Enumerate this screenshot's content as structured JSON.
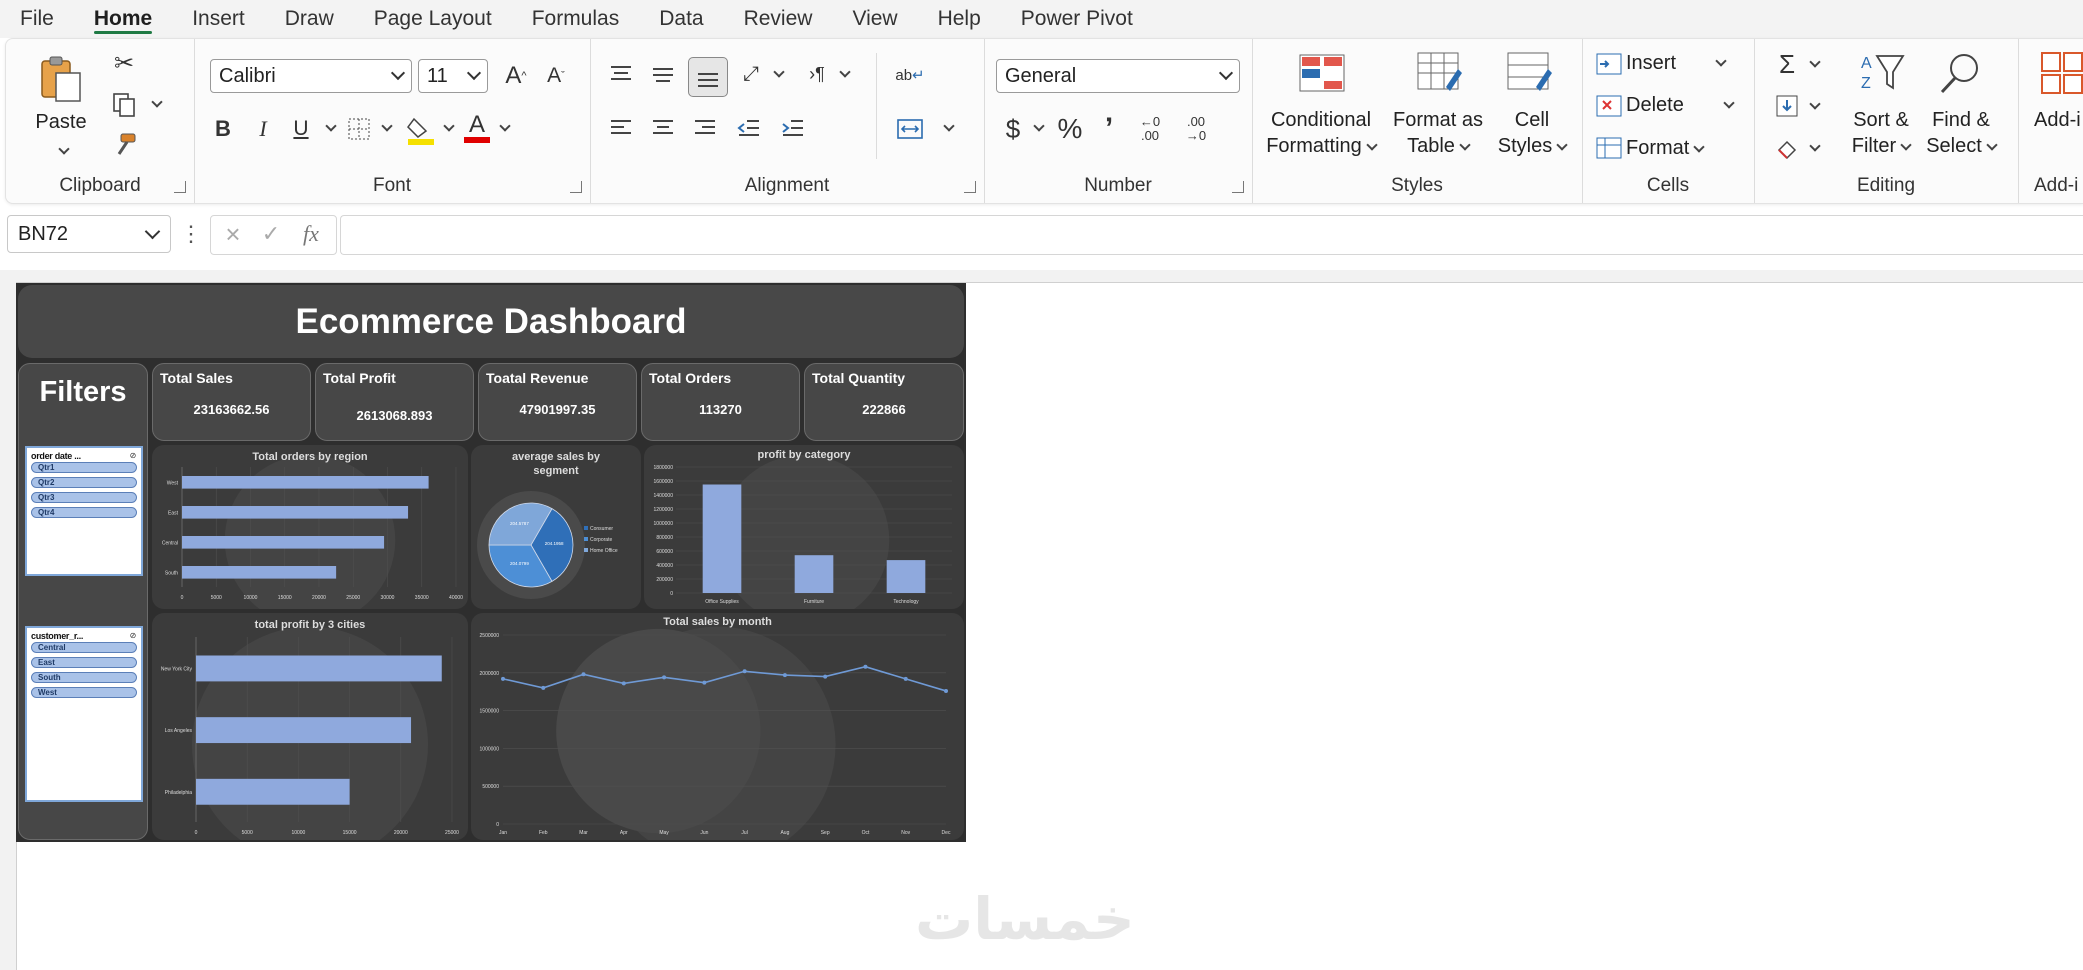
{
  "menu": [
    "File",
    "Home",
    "Insert",
    "Draw",
    "Page Layout",
    "Formulas",
    "Data",
    "Review",
    "View",
    "Help",
    "Power Pivot"
  ],
  "ribbon": {
    "clipboard": {
      "label": "Clipboard",
      "paste": "Paste"
    },
    "font": {
      "label": "Font",
      "font_name": "Calibri",
      "font_size": "11"
    },
    "alignment": {
      "label": "Alignment"
    },
    "number": {
      "label": "Number",
      "format": "General"
    },
    "styles": {
      "label": "Styles",
      "conditional_1": "Conditional",
      "conditional_2": "Formatting",
      "format_table_1": "Format as",
      "format_table_2": "Table",
      "cell_styles_1": "Cell",
      "cell_styles_2": "Styles"
    },
    "cells": {
      "label": "Cells",
      "insert": "Insert",
      "delete": "Delete",
      "format": "Format"
    },
    "editing": {
      "label": "Editing",
      "sort_1": "Sort &",
      "sort_2": "Filter",
      "find_1": "Find &",
      "find_2": "Select"
    },
    "addins": {
      "label": "Add-i",
      "addins_btn": "Add-i"
    }
  },
  "formula_bar": {
    "name_box": "BN72",
    "formula": ""
  },
  "dashboard": {
    "title": "Ecommerce Dashboard",
    "filters_label": "Filters",
    "kpis": [
      {
        "label": "Total Sales",
        "value": "23163662.56"
      },
      {
        "label": "Total Profit",
        "value": "2613068.893"
      },
      {
        "label": "Toatal Revenue",
        "value": "47901997.35"
      },
      {
        "label": "Total Orders",
        "value": "113270"
      },
      {
        "label": "Total Quantity",
        "value": "222866"
      }
    ],
    "slicer1": {
      "header": "order date ...",
      "items": [
        "Qtr1",
        "Qtr2",
        "Qtr3",
        "Qtr4"
      ]
    },
    "slicer2": {
      "header": "customer_r...",
      "items": [
        "Central",
        "East",
        "South",
        "West"
      ]
    }
  },
  "chart_data": [
    {
      "type": "bar",
      "orientation": "horizontal",
      "title": "Total orders by region",
      "categories": [
        "West",
        "East",
        "Central",
        "South"
      ],
      "values": [
        36000,
        33000,
        29500,
        22500
      ],
      "xticks": [
        "0",
        "5000",
        "10000",
        "15000",
        "20000",
        "25000",
        "30000",
        "35000",
        "40000"
      ],
      "xlim": [
        0,
        40000
      ]
    },
    {
      "type": "pie",
      "title": "average sales by segment",
      "categories": [
        "Consumer",
        "Corporate",
        "Home Office"
      ],
      "values": [
        1,
        1,
        1
      ],
      "slice_labels": [
        "204.1958",
        "204.0799",
        "204.5787"
      ],
      "legend": "right"
    },
    {
      "type": "bar",
      "title": "profit by category",
      "categories": [
        "Office Supplies",
        "Furniture",
        "Technology"
      ],
      "values": [
        1550000,
        540000,
        470000
      ],
      "yticks": [
        "0",
        "200000",
        "400000",
        "600000",
        "800000",
        "1000000",
        "1200000",
        "1400000",
        "1600000",
        "1800000"
      ],
      "ylim": [
        0,
        1800000
      ]
    },
    {
      "type": "bar",
      "orientation": "horizontal",
      "title": "total profit by 3 cities",
      "categories": [
        "New York City",
        "Los Angeles",
        "Philadelphia"
      ],
      "values": [
        24000,
        21000,
        15000
      ],
      "xticks": [
        "0",
        "5000",
        "10000",
        "15000",
        "20000",
        "25000"
      ],
      "xlim": [
        0,
        25000
      ]
    },
    {
      "type": "line",
      "title": "Total sales by month",
      "categories": [
        "Jan",
        "Feb",
        "Mar",
        "Apr",
        "May",
        "Jun",
        "Jul",
        "Aug",
        "Sep",
        "Oct",
        "Nov",
        "Dec"
      ],
      "values": [
        1920000,
        1800000,
        1980000,
        1860000,
        1940000,
        1870000,
        2020000,
        1970000,
        1950000,
        2080000,
        1920000,
        1760000
      ],
      "yticks": [
        "0",
        "500000",
        "1000000",
        "1500000",
        "2000000",
        "2500000"
      ],
      "ylim": [
        0,
        2500000
      ]
    }
  ],
  "watermark": "خمسات"
}
